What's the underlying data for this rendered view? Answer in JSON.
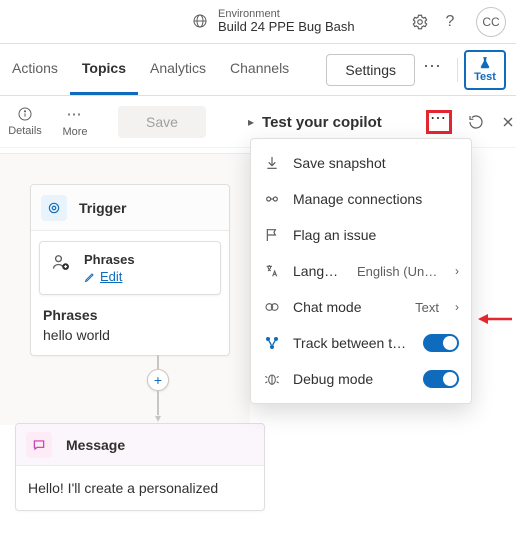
{
  "header": {
    "env_label": "Environment",
    "env_name": "Build 24 PPE Bug Bash",
    "help": "?",
    "avatar_initials": "CC"
  },
  "tabs": {
    "items": [
      "Actions",
      "Topics",
      "Analytics",
      "Channels"
    ],
    "active_index": 1,
    "settings_label": "Settings",
    "test_label": "Test"
  },
  "subbar": {
    "details_label": "Details",
    "more_label": "More",
    "save_label": "Save"
  },
  "test_panel": {
    "title": "Test your copilot"
  },
  "menu": {
    "save_snapshot": "Save snapshot",
    "manage_connections": "Manage connections",
    "flag_issue": "Flag an issue",
    "language_label": "Language",
    "language_value": "English (United States)",
    "chat_mode_label": "Chat mode",
    "chat_mode_value": "Text",
    "track_between_topics": "Track between topics",
    "track_on": true,
    "debug_mode_label": "Debug mode",
    "debug_on": true
  },
  "canvas": {
    "trigger_title": "Trigger",
    "phrases_card_title": "Phrases",
    "edit_label": "Edit",
    "phrases_label": "Phrases",
    "phrases_value": "hello world",
    "message_title": "Message",
    "message_text": "Hello! I'll create a personalized"
  }
}
